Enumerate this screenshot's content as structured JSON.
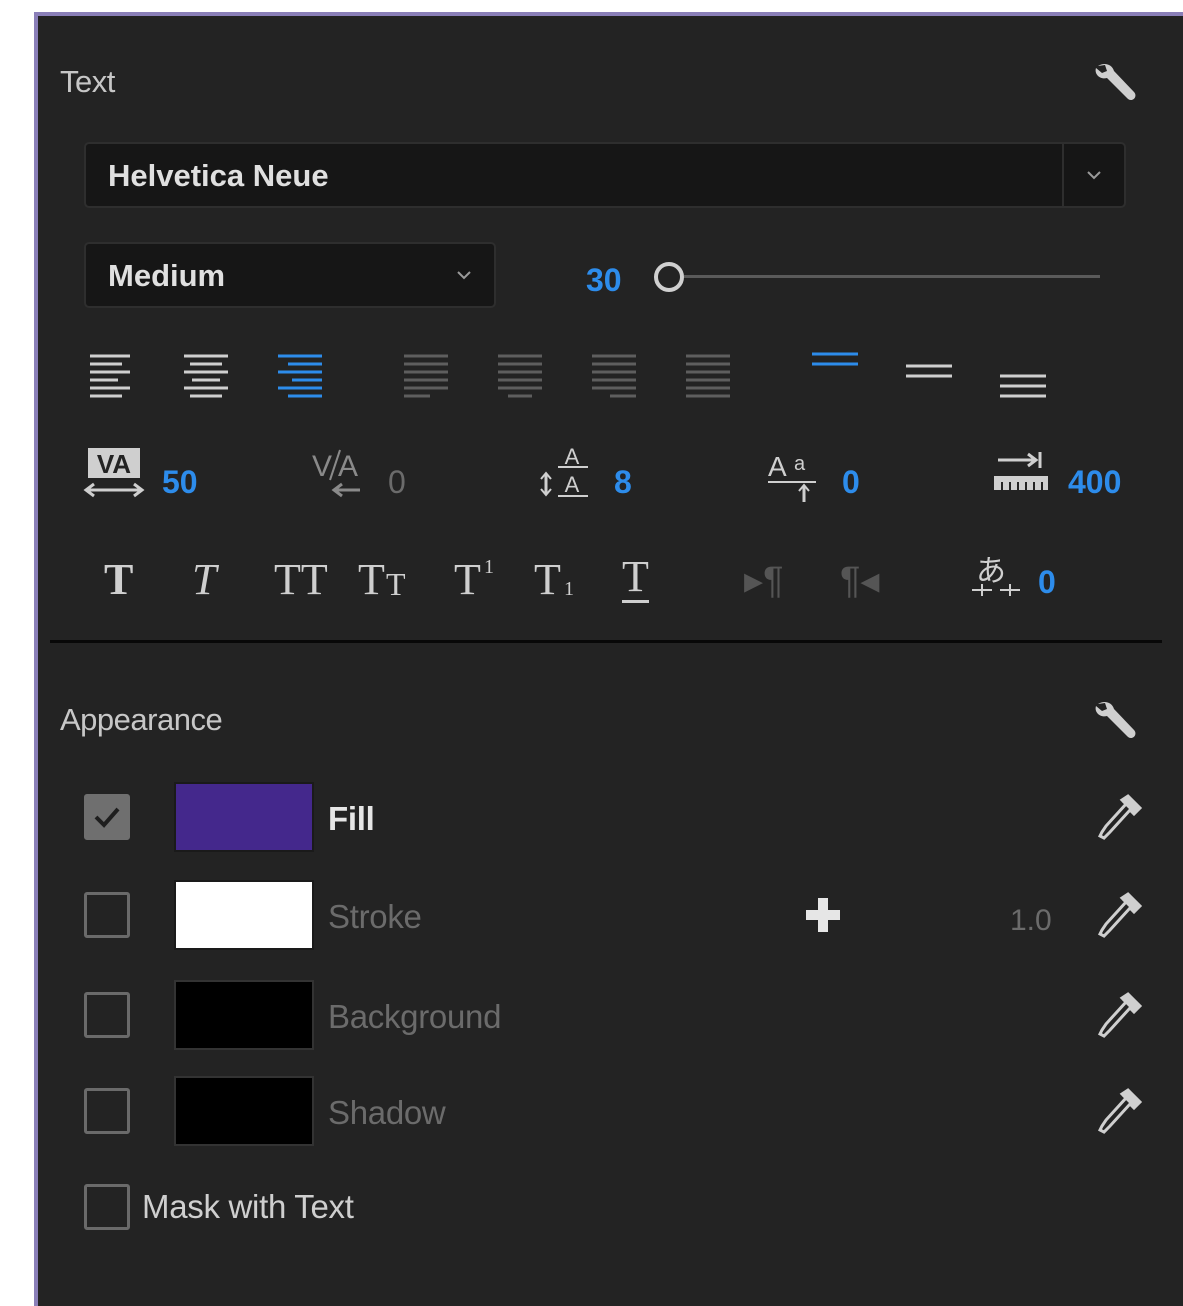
{
  "text_section": {
    "title": "Text",
    "font_family": "Helvetica Neue",
    "font_style": "Medium",
    "font_size": "30",
    "font_size_slider_fraction": 0.0,
    "align_icons": [
      "align-left-icon",
      "align-center-icon",
      "align-right-icon",
      "justify-last-left-icon",
      "justify-last-center-icon",
      "justify-last-right-icon",
      "justify-all-icon",
      "align-top-icon",
      "align-middle-icon",
      "align-bottom-icon"
    ],
    "tracking": "50",
    "kerning": "0",
    "leading": "8",
    "baseline_shift": "0",
    "tab_width": "400",
    "tsume": "0",
    "style_icons": [
      "faux-bold-icon",
      "faux-italic-icon",
      "all-caps-icon",
      "small-caps-icon",
      "superscript-icon",
      "subscript-icon",
      "underline-icon",
      "ltr-direction-icon",
      "rtl-direction-icon",
      "tsume-icon"
    ],
    "style_glyphs": {
      "bold": "T",
      "italic": "T",
      "all_caps": "TT",
      "small_caps_big": "T",
      "small_caps_small": "T",
      "super_base": "T",
      "super_mark": "1",
      "sub_base": "T",
      "sub_mark": "1",
      "underline": "T",
      "ltr": "▸¶",
      "rtl": "¶◂",
      "tsume_glyph": "あ"
    }
  },
  "appearance_section": {
    "title": "Appearance",
    "items": [
      {
        "label": "Fill",
        "checked": true,
        "color": "#44288c",
        "icon": "eyedropper-icon"
      },
      {
        "label": "Stroke",
        "checked": false,
        "color": "#ffffff",
        "icon": "eyedropper-icon",
        "width": "1.0",
        "add_icon": "plus-icon"
      },
      {
        "label": "Background",
        "checked": false,
        "color": "#000000",
        "icon": "eyedropper-icon"
      },
      {
        "label": "Shadow",
        "checked": false,
        "color": "#000000",
        "icon": "eyedropper-icon"
      }
    ],
    "mask_label": "Mask with Text",
    "mask_checked": false
  },
  "colors": {
    "panel_bg": "#232323",
    "accent_blue": "#2d8ceb",
    "panel_border": "#8a7fb8"
  }
}
